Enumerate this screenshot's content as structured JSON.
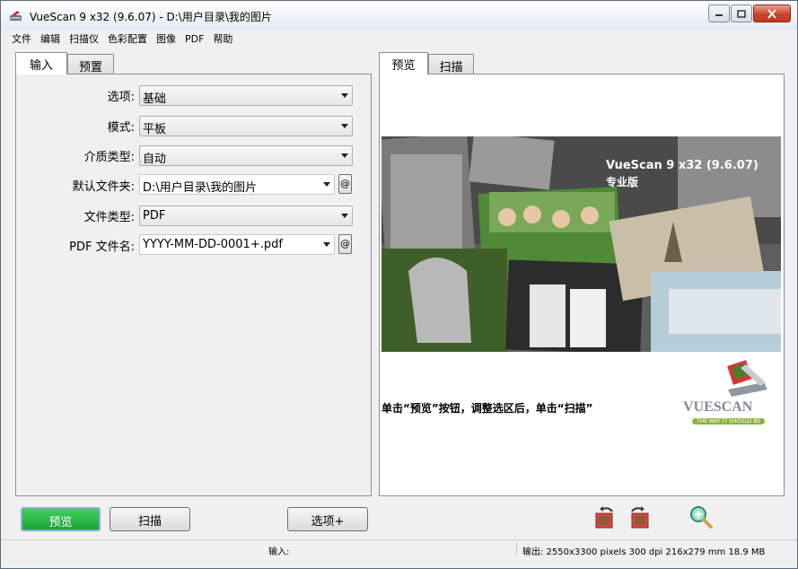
{
  "window": {
    "title": "VueScan 9 x32 (9.6.07) - D:\\用户目录\\我的图片"
  },
  "menu": [
    "文件",
    "编辑",
    "扫描仪",
    "色彩配置",
    "图像",
    "PDF",
    "帮助"
  ],
  "left_tabs": [
    {
      "label": "输入",
      "active": true
    },
    {
      "label": "预置",
      "active": false
    }
  ],
  "right_tabs": [
    {
      "label": "预览",
      "active": true
    },
    {
      "label": "扫描",
      "active": false
    }
  ],
  "form": {
    "options": {
      "label": "选项:",
      "value": "基础"
    },
    "mode": {
      "label": "模式:",
      "value": "平板"
    },
    "media": {
      "label": "介质类型:",
      "value": "自动"
    },
    "default_folder": {
      "label": "默认文件夹:",
      "value": "D:\\用户目录\\我的图片"
    },
    "file_type": {
      "label": "文件类型:",
      "value": "PDF"
    },
    "pdf_filename": {
      "label": "PDF 文件名:",
      "value": "YYYY-MM-DD-0001+.pdf"
    },
    "at_label": "@"
  },
  "preview": {
    "brand": "VueScan 9 x32 (9.6.07)",
    "edition": "专业版",
    "instruction": "单击“预览”按钮，调整选区后，单击“扫描”",
    "logo_text": "VUESCAN",
    "logo_tagline": "THE WAY IT SHOULD BE"
  },
  "buttons": {
    "preview": "预览",
    "scan": "扫描",
    "options_plus": "选项+"
  },
  "status": {
    "input": "输入:",
    "output": "输出: 2550x3300 pixels 300 dpi 216x279 mm 18.9 MB"
  },
  "icons": {
    "app": "vuescan-app-icon",
    "rotate_left": "rotate-left-icon",
    "rotate_right": "rotate-right-icon",
    "zoom": "zoom-in-icon"
  },
  "colors": {
    "preview_button": "#22b03f",
    "title_close": "#c7452c",
    "window_bg": "#f0f0f0"
  }
}
